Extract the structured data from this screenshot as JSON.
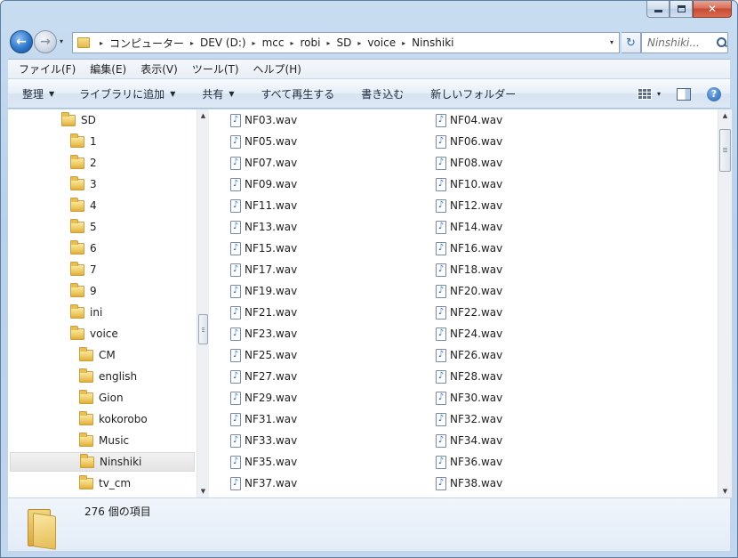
{
  "caption": {
    "minimize": "—",
    "maximize": "□",
    "close": "✕"
  },
  "nav": {
    "back_glyph": "←",
    "forward_glyph": "→",
    "history_glyph": "▾"
  },
  "address": {
    "crumbs": [
      "コンピューター",
      "DEV (D:)",
      "mcc",
      "robi",
      "SD",
      "voice",
      "Ninshiki"
    ],
    "separator": "▸",
    "dropdown_glyph": "▾",
    "refresh_glyph": "↻"
  },
  "search": {
    "placeholder": "Ninshiki..."
  },
  "menu": [
    "ファイル(F)",
    "編集(E)",
    "表示(V)",
    "ツール(T)",
    "ヘルプ(H)"
  ],
  "commands": [
    {
      "label": "整理",
      "dropdown": true
    },
    {
      "label": "ライブラリに追加",
      "dropdown": true
    },
    {
      "label": "共有",
      "dropdown": true
    },
    {
      "label": "すべて再生する",
      "dropdown": false
    },
    {
      "label": "書き込む",
      "dropdown": false
    },
    {
      "label": "新しいフォルダー",
      "dropdown": false
    }
  ],
  "command_icons": {
    "views": "views-icon",
    "preview_pane": "preview-pane-icon",
    "help": "?"
  },
  "tree": [
    {
      "label": "SD",
      "level": 0
    },
    {
      "label": "1",
      "level": 1
    },
    {
      "label": "2",
      "level": 1
    },
    {
      "label": "3",
      "level": 1
    },
    {
      "label": "4",
      "level": 1
    },
    {
      "label": "5",
      "level": 1
    },
    {
      "label": "6",
      "level": 1
    },
    {
      "label": "7",
      "level": 1
    },
    {
      "label": "9",
      "level": 1
    },
    {
      "label": "ini",
      "level": 1
    },
    {
      "label": "voice",
      "level": 1
    },
    {
      "label": "CM",
      "level": 2
    },
    {
      "label": "english",
      "level": 2
    },
    {
      "label": "Gion",
      "level": 2
    },
    {
      "label": "kokorobo",
      "level": 2
    },
    {
      "label": "Music",
      "level": 2
    },
    {
      "label": "Ninshiki",
      "level": 2,
      "selected": true
    },
    {
      "label": "tv_cm",
      "level": 2
    }
  ],
  "files": [
    [
      "NF03.wav",
      "NF04.wav"
    ],
    [
      "NF05.wav",
      "NF06.wav"
    ],
    [
      "NF07.wav",
      "NF08.wav"
    ],
    [
      "NF09.wav",
      "NF10.wav"
    ],
    [
      "NF11.wav",
      "NF12.wav"
    ],
    [
      "NF13.wav",
      "NF14.wav"
    ],
    [
      "NF15.wav",
      "NF16.wav"
    ],
    [
      "NF17.wav",
      "NF18.wav"
    ],
    [
      "NF19.wav",
      "NF20.wav"
    ],
    [
      "NF21.wav",
      "NF22.wav"
    ],
    [
      "NF23.wav",
      "NF24.wav"
    ],
    [
      "NF25.wav",
      "NF26.wav"
    ],
    [
      "NF27.wav",
      "NF28.wav"
    ],
    [
      "NF29.wav",
      "NF30.wav"
    ],
    [
      "NF31.wav",
      "NF32.wav"
    ],
    [
      "NF33.wav",
      "NF34.wav"
    ],
    [
      "NF35.wav",
      "NF36.wav"
    ],
    [
      "NF37.wav",
      "NF38.wav"
    ]
  ],
  "file_icon": {
    "name": "audio-file-icon",
    "glyph": "♪"
  },
  "scroll_glyphs": {
    "up": "▲",
    "down": "▼"
  },
  "status": {
    "item_count": "276 個の項目"
  }
}
